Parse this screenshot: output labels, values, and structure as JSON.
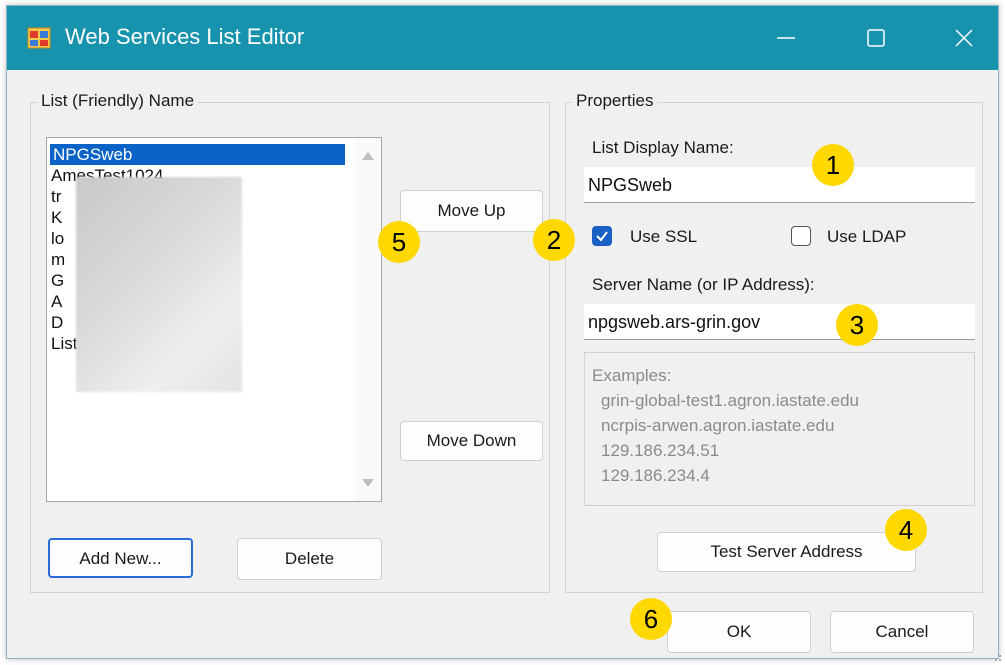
{
  "window": {
    "title": "Web Services List Editor",
    "titlebar_color": "#1793ad"
  },
  "left_group": {
    "label": "List (Friendly) Name",
    "list_items": [
      {
        "label": "NPGSweb",
        "selected": true
      },
      {
        "label": "AmesTest1024",
        "selected": false
      },
      {
        "label": "tr",
        "selected": false
      },
      {
        "label": "K",
        "selected": false
      },
      {
        "label": "lo",
        "selected": false
      },
      {
        "label": "m",
        "selected": false
      },
      {
        "label": "G",
        "selected": false
      },
      {
        "label": "A",
        "selected": false
      },
      {
        "label": "D",
        "selected": false
      },
      {
        "label": "List (Friendly) Name",
        "selected": false
      }
    ],
    "add_label": "Add New...",
    "delete_label": "Delete"
  },
  "middle": {
    "move_up_label": "Move Up",
    "move_down_label": "Move Down"
  },
  "properties": {
    "label": "Properties",
    "display_name_label": "List Display Name:",
    "display_name_value": "NPGSweb",
    "use_ssl_label": "Use SSL",
    "use_ssl_checked": true,
    "use_ldap_label": "Use LDAP",
    "use_ldap_checked": false,
    "server_label": "Server Name (or IP Address):",
    "server_value": "npgsweb.ars-grin.gov",
    "examples_title": "Examples:",
    "examples": [
      "grin-global-test1.agron.iastate.edu",
      "ncrpis-arwen.agron.iastate.edu",
      "129.186.234.51",
      "129.186.234.4"
    ],
    "test_label": "Test Server Address"
  },
  "footer": {
    "ok_label": "OK",
    "cancel_label": "Cancel"
  },
  "callouts": [
    "1",
    "2",
    "3",
    "4",
    "5",
    "6"
  ],
  "icons": {
    "app": "app-window-icon",
    "minimize": "minimize-icon",
    "maximize": "maximize-icon",
    "close": "close-icon",
    "check": "check-icon",
    "scroll_up": "scroll-up-arrow-icon",
    "scroll_down": "scroll-down-arrow-icon",
    "grip": "resize-grip-icon"
  },
  "colors": {
    "accent": "#1a5fc4",
    "selection": "#0a64c8",
    "callout": "#ffd800"
  }
}
